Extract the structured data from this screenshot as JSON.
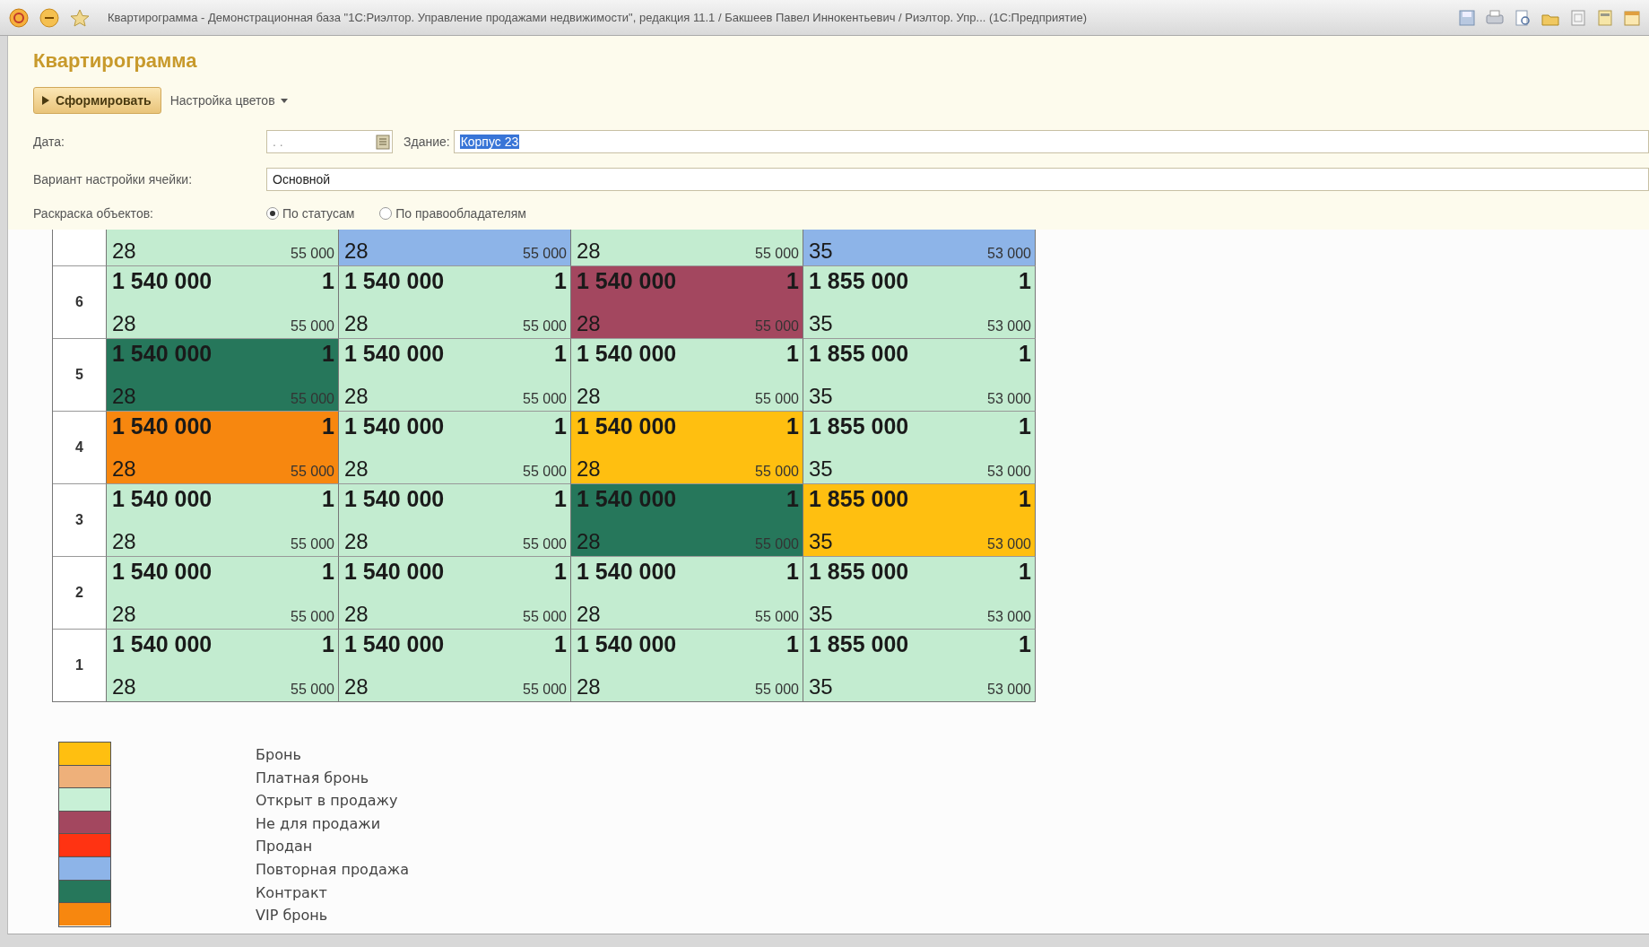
{
  "window": {
    "title": "Квартирограмма - Демонстрационная база \"1С:Риэлтор. Управление продажами недвижимости\", редакция 11.1 / Бакшеев Павел Иннокентьевич / Риэлтор. Упр...  (1С:Предприятие)"
  },
  "form": {
    "heading": "Квартирограмма",
    "generate_button": "Сформировать",
    "colors_menu": "Настройка цветов",
    "date": {
      "label": "Дата:",
      "placeholder": ". ."
    },
    "building": {
      "label": "Здание:",
      "value": "Корпус 23",
      "highlighted": true
    },
    "cell_variant": {
      "label": "Вариант настройки ячейки:",
      "value": "Основной"
    },
    "coloring": {
      "label": "Раскраска объектов:",
      "options": [
        {
          "label": "По статусам",
          "selected": true
        },
        {
          "label": "По правообладателям",
          "selected": false
        }
      ]
    }
  },
  "floors": [
    {
      "cells": [
        {
          "area": "28",
          "price_per_m2": "55 000",
          "color": "#c3ecd0"
        },
        {
          "area": "28",
          "price_per_m2": "55 000",
          "color": "#8db4e8"
        },
        {
          "area": "28",
          "price_per_m2": "55 000",
          "color": "#c3ecd0"
        },
        {
          "area": "35",
          "price_per_m2": "53 000",
          "color": "#8db4e8"
        }
      ]
    },
    {
      "floor": "6",
      "cells": [
        {
          "price": "1 540 000",
          "rooms": "1",
          "area": "28",
          "price_per_m2": "55 000",
          "color": "#c3ecd0"
        },
        {
          "price": "1 540 000",
          "rooms": "1",
          "area": "28",
          "price_per_m2": "55 000",
          "color": "#c3ecd0"
        },
        {
          "price": "1 540 000",
          "rooms": "1",
          "area": "28",
          "price_per_m2": "55 000",
          "color": "#a3475f"
        },
        {
          "price": "1 855 000",
          "rooms": "1",
          "area": "35",
          "price_per_m2": "53 000",
          "color": "#c3ecd0"
        }
      ]
    },
    {
      "floor": "5",
      "cells": [
        {
          "price": "1 540 000",
          "rooms": "1",
          "area": "28",
          "price_per_m2": "55 000",
          "color": "#26775b"
        },
        {
          "price": "1 540 000",
          "rooms": "1",
          "area": "28",
          "price_per_m2": "55 000",
          "color": "#c3ecd0"
        },
        {
          "price": "1 540 000",
          "rooms": "1",
          "area": "28",
          "price_per_m2": "55 000",
          "color": "#c3ecd0"
        },
        {
          "price": "1 855 000",
          "rooms": "1",
          "area": "35",
          "price_per_m2": "53 000",
          "color": "#c3ecd0"
        }
      ]
    },
    {
      "floor": "4",
      "cells": [
        {
          "price": "1 540 000",
          "rooms": "1",
          "area": "28",
          "price_per_m2": "55 000",
          "color": "#f7870f"
        },
        {
          "price": "1 540 000",
          "rooms": "1",
          "area": "28",
          "price_per_m2": "55 000",
          "color": "#c3ecd0"
        },
        {
          "price": "1 540 000",
          "rooms": "1",
          "area": "28",
          "price_per_m2": "55 000",
          "color": "#ffbf10"
        },
        {
          "price": "1 855 000",
          "rooms": "1",
          "area": "35",
          "price_per_m2": "53 000",
          "color": "#c3ecd0"
        }
      ]
    },
    {
      "floor": "3",
      "cells": [
        {
          "price": "1 540 000",
          "rooms": "1",
          "area": "28",
          "price_per_m2": "55 000",
          "color": "#c3ecd0"
        },
        {
          "price": "1 540 000",
          "rooms": "1",
          "area": "28",
          "price_per_m2": "55 000",
          "color": "#c3ecd0"
        },
        {
          "price": "1 540 000",
          "rooms": "1",
          "area": "28",
          "price_per_m2": "55 000",
          "color": "#26775b"
        },
        {
          "price": "1 855 000",
          "rooms": "1",
          "area": "35",
          "price_per_m2": "53 000",
          "color": "#ffbf10"
        }
      ]
    },
    {
      "floor": "2",
      "cells": [
        {
          "price": "1 540 000",
          "rooms": "1",
          "area": "28",
          "price_per_m2": "55 000",
          "color": "#c3ecd0"
        },
        {
          "price": "1 540 000",
          "rooms": "1",
          "area": "28",
          "price_per_m2": "55 000",
          "color": "#c3ecd0"
        },
        {
          "price": "1 540 000",
          "rooms": "1",
          "area": "28",
          "price_per_m2": "55 000",
          "color": "#c3ecd0"
        },
        {
          "price": "1 855 000",
          "rooms": "1",
          "area": "35",
          "price_per_m2": "53 000",
          "color": "#c3ecd0"
        }
      ]
    },
    {
      "floor": "1",
      "cells": [
        {
          "price": "1 540 000",
          "rooms": "1",
          "area": "28",
          "price_per_m2": "55 000",
          "color": "#c3ecd0"
        },
        {
          "price": "1 540 000",
          "rooms": "1",
          "area": "28",
          "price_per_m2": "55 000",
          "color": "#c3ecd0"
        },
        {
          "price": "1 540 000",
          "rooms": "1",
          "area": "28",
          "price_per_m2": "55 000",
          "color": "#c3ecd0"
        },
        {
          "price": "1 855 000",
          "rooms": "1",
          "area": "35",
          "price_per_m2": "53 000",
          "color": "#c3ecd0"
        }
      ]
    }
  ],
  "legend": [
    {
      "label": "Бронь",
      "color": "#ffbf10"
    },
    {
      "label": "Платная бронь",
      "color": "#eeb07a"
    },
    {
      "label": "Открыт в продажу",
      "color": "#c8f0d6"
    },
    {
      "label": "Не для продажи",
      "color": "#a3475f"
    },
    {
      "label": "Продан",
      "color": "#ff3312"
    },
    {
      "label": "Повторная продажа",
      "color": "#8db4e8"
    },
    {
      "label": "Контракт",
      "color": "#26775b"
    },
    {
      "label": "VIP бронь",
      "color": "#f7870f"
    }
  ]
}
